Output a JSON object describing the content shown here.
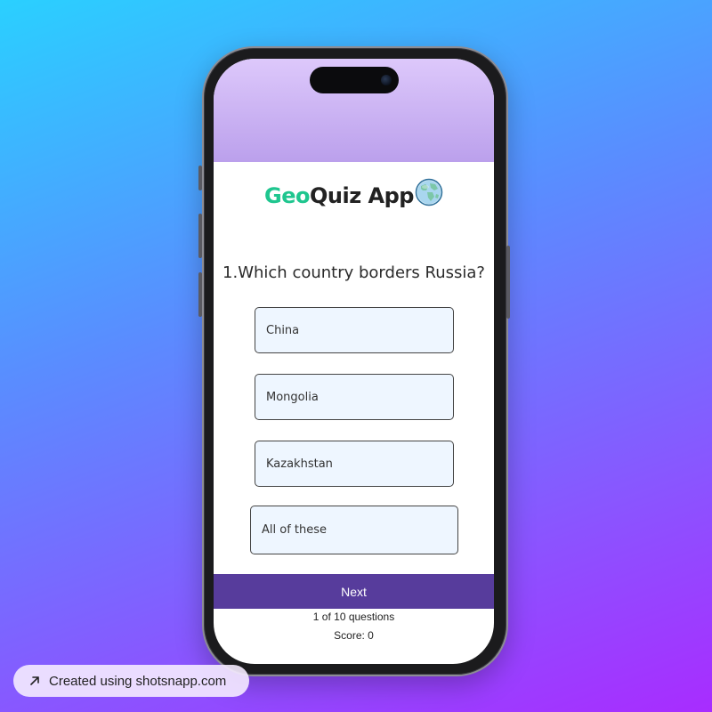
{
  "app": {
    "title_accent": "Geo",
    "title_rest": "Quiz App",
    "globe_icon": "globe-icon"
  },
  "quiz": {
    "question": "1.Which country borders Russia?",
    "options": [
      "China",
      "Mongolia",
      "Kazakhstan",
      "All of these"
    ],
    "next_label": "Next",
    "progress": "1 of 10 questions",
    "score": "Score: 0"
  },
  "footer": {
    "credit": "Created using shotsnapp.com",
    "credit_icon": "arrow-up-right-icon"
  },
  "colors": {
    "accent_green": "#1fc68f",
    "next_button": "#573c9c",
    "option_bg": "#eef6ff",
    "header_purple": "#c9b2f5"
  }
}
